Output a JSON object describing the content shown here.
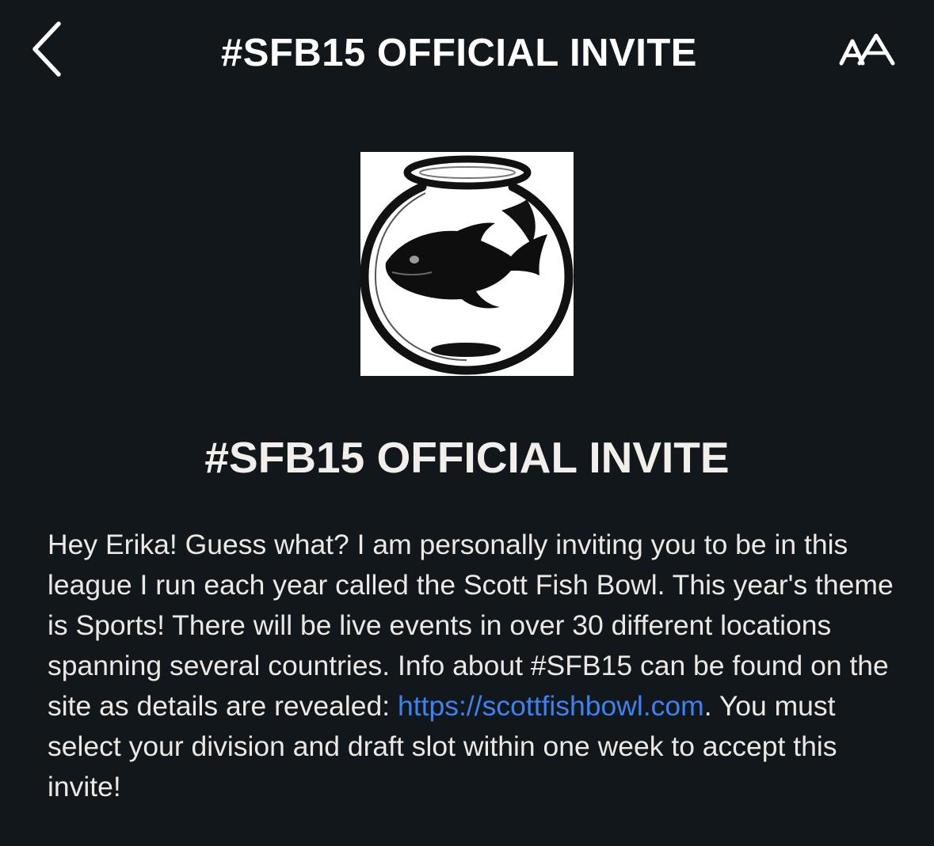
{
  "nav": {
    "title": "#SFB15 OFFICIAL INVITE",
    "back_icon": "chevron-left-icon",
    "text_size_icon": "text-size-icon",
    "text_size_label": "AA"
  },
  "hero": {
    "icon": "fishbowl-logo"
  },
  "article": {
    "title": "#SFB15 OFFICIAL INVITE",
    "body_before_link": "Hey Erika! Guess what? I am personally inviting you to be in this league I run each year called the Scott Fish Bowl. This year's theme is Sports! There will be live events in over 30 different locations spanning several countries. Info about #SFB15 can be found on the site as details are revealed: ",
    "link_text": "https://scottfishbowl.com",
    "body_after_link": ". You must select your division and draft slot within one week to accept this invite!"
  },
  "colors": {
    "background": "#12171b",
    "text": "#ece8e3",
    "link": "#3d82f0"
  }
}
